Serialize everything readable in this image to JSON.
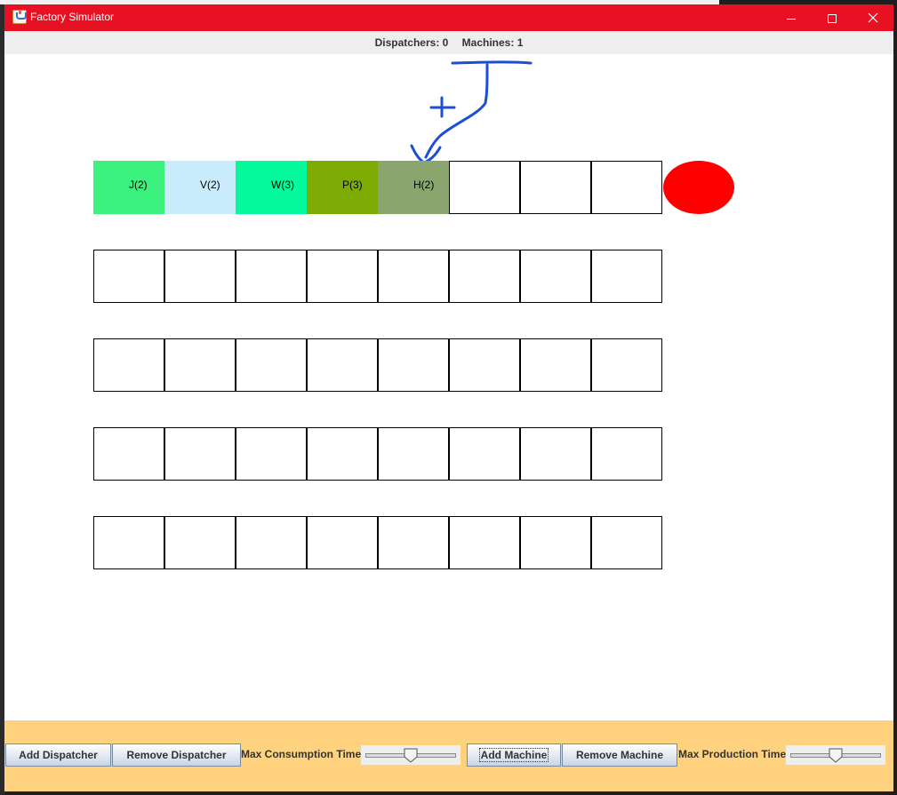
{
  "window": {
    "title": "Factory Simulator",
    "accent_color": "#e81123",
    "controls": [
      "minimize-icon",
      "maximize-icon",
      "close-icon"
    ]
  },
  "status": {
    "dispatchers": "Dispatchers: 0",
    "machines": "Machines: 1"
  },
  "queues": {
    "rows": 5,
    "slots_per_row": 8,
    "jobs": [
      {
        "label": "J(2)",
        "color": "#3af27d"
      },
      {
        "label": "V(2)",
        "color": "#c8ecfb"
      },
      {
        "label": "W(3)",
        "color": "#05fa9c"
      },
      {
        "label": "P(3)",
        "color": "#7fab05"
      },
      {
        "label": "H(2)",
        "color": "#8aa56e"
      }
    ]
  },
  "machine": {
    "color": "#ff0000"
  },
  "annotation": {
    "color": "#1a4fd6"
  },
  "controls_panel": {
    "background": "#ffd27f",
    "add_dispatcher": "Add Dispatcher",
    "remove_dispatcher": "Remove Dispatcher",
    "max_consumption_label": "Max Consumption Time",
    "consumption_slider_level": 0.5,
    "add_machine": "Add Machine",
    "remove_machine": "Remove Machine",
    "max_production_label": "Max Production Time",
    "production_slider_level": 0.5
  }
}
